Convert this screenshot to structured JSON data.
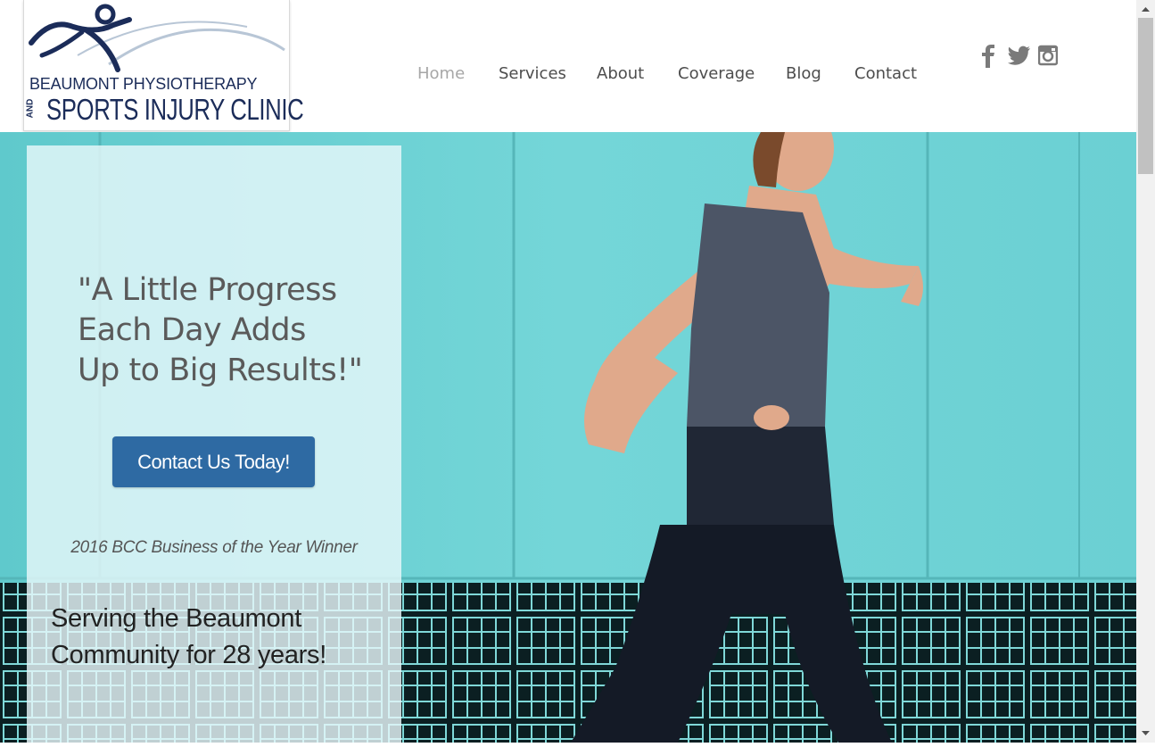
{
  "logo": {
    "line1": "BEAUMONT PHYSIOTHERAPY",
    "and": "AND",
    "line2": "SPORTS INJURY CLINIC"
  },
  "nav": {
    "items": [
      {
        "label": "Home",
        "active": true
      },
      {
        "label": "Services",
        "active": false
      },
      {
        "label": "About",
        "active": false
      },
      {
        "label": "Coverage",
        "active": false
      },
      {
        "label": "Blog",
        "active": false
      },
      {
        "label": "Contact",
        "active": false
      }
    ]
  },
  "social": {
    "icons": [
      "facebook-icon",
      "twitter-icon",
      "instagram-icon"
    ]
  },
  "hero": {
    "quote": "\"A Little Progress Each Day Adds Up to Big Results!\"",
    "quote_lines": [
      "\"A Little Progress",
      "Each Day Adds",
      "Up to Big Results!\""
    ],
    "cta_label": "Contact Us Today!",
    "award": "2016 BCC Business of the Year Winner",
    "serving_lines": [
      "Serving the Beaumont",
      "Community for 28 years!"
    ]
  },
  "colors": {
    "brand_navy": "#1b2c59",
    "cta_blue": "#2e6aa3",
    "teal_wall": "#6fd3d6",
    "nav_text": "#4d4d4d",
    "nav_active": "#a7a7a7"
  }
}
